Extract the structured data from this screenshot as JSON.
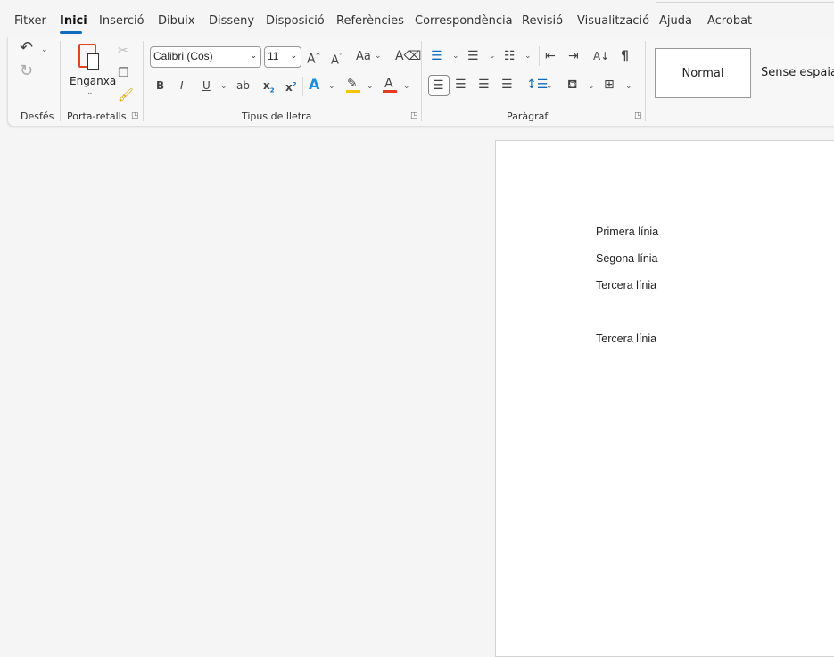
{
  "menu": [
    "Fitxer",
    "Inici",
    "Inserció",
    "Dibuix",
    "Disseny",
    "Disposició",
    "Referències",
    "Correspondència",
    "Revisió",
    "Visualització",
    "Ajuda",
    "Acrobat"
  ],
  "active_tab": "Inici",
  "ribbon": {
    "groups": {
      "undo": "Desfés",
      "clipboard": "Porta-retalls",
      "font": "Tipus de lletra",
      "paragraph": "Paràgraf"
    },
    "paste_label": "Enganxa",
    "font_name": "Calibri (Cos)",
    "font_size": "11",
    "change_case": "Aa",
    "bold": "B",
    "italic": "I",
    "underline": "U",
    "strike": "ab",
    "subscript": "x",
    "superscript": "x",
    "pilcrow": "¶",
    "styles": [
      "Normal",
      "Sense espaiat"
    ],
    "colors": {
      "highlight": "#f5c400",
      "font_color": "#e03c1e",
      "accent": "#0f6cbd"
    }
  },
  "document": {
    "lines": [
      "Primera línia",
      "Segona línia",
      "Tercera línia",
      "Tercera línia"
    ]
  }
}
